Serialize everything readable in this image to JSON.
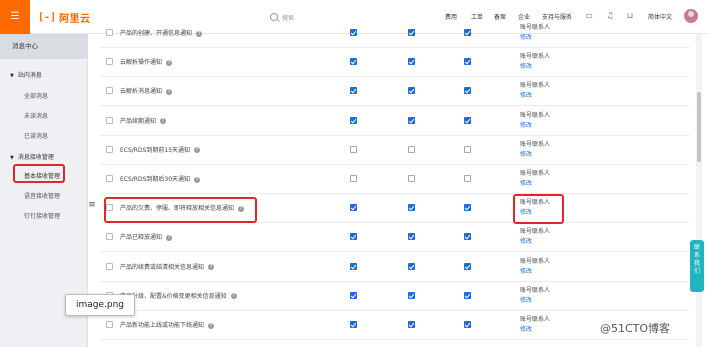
{
  "topbar": {
    "menu_icon": "☰",
    "logo_mark": "[-]",
    "logo_text": "阿里云",
    "search_placeholder": "搜索",
    "nav": [
      "费用",
      "工单",
      "备案",
      "企业",
      "支持与服务"
    ],
    "icons": [
      "screen-icon",
      "bell-icon",
      "cart-icon"
    ],
    "language": "简体中文"
  },
  "sidebar": {
    "title": "消息中心",
    "groups": [
      {
        "label": "站内消息",
        "items": [
          "全部消息",
          "未读消息",
          "已读消息"
        ]
      },
      {
        "label": "消息接收管理",
        "items": [
          "基本接收管理",
          "语音接收管理",
          "钉钉接收管理"
        ]
      }
    ],
    "collapse_icon": "≡"
  },
  "table": {
    "rows": [
      {
        "label": "产品的创建、开通信息通知",
        "checks": [
          true,
          true,
          true
        ],
        "contact": "账号联系人",
        "edit": "修改"
      },
      {
        "label": "云解析操作通知",
        "checks": [
          true,
          true,
          true
        ],
        "contact": "账号联系人",
        "edit": "修改"
      },
      {
        "label": "云解析消息通知",
        "checks": [
          true,
          true,
          true
        ],
        "contact": "账号联系人",
        "edit": "修改"
      },
      {
        "label": "产品续期通知",
        "checks": [
          true,
          true,
          true
        ],
        "contact": "账号联系人",
        "edit": "修改"
      },
      {
        "label": "ECS/RDS到期前15天通知",
        "checks": [
          false,
          false,
          false
        ],
        "contact": "账号联系人",
        "edit": "修改"
      },
      {
        "label": "ECS/RDS到期后30天通知",
        "checks": [
          false,
          false,
          false
        ],
        "contact": "账号联系人",
        "edit": "修改"
      },
      {
        "label": "产品的欠费、停服、即将释放相关信息通知",
        "checks": [
          true,
          true,
          true
        ],
        "contact": "账号联系人",
        "edit": "修改"
      },
      {
        "label": "产品已释放通知",
        "checks": [
          true,
          true,
          true
        ],
        "contact": "账号联系人",
        "edit": "修改"
      },
      {
        "label": "产品的续费或结清相关信息通知",
        "checks": [
          true,
          true,
          true
        ],
        "contact": "账号联系人",
        "edit": "修改"
      },
      {
        "label": "产品升级、配置&价格变更相关信息通知",
        "checks": [
          true,
          true,
          true
        ],
        "contact": "账号联系人",
        "edit": "修改"
      },
      {
        "label": "产品新功能上线或功能下线通知",
        "checks": [
          true,
          true,
          true
        ],
        "contact": "账号联系人",
        "edit": "修改"
      }
    ]
  },
  "float_contact": [
    "联",
    "系",
    "我",
    "们"
  ],
  "tooltip": "image.png",
  "watermark": "@51CTO博客",
  "colors": {
    "brand": "#ff6a00",
    "checkbox": "#1d6cd6",
    "highlight": "#e0262a",
    "float": "#22b3c1"
  }
}
